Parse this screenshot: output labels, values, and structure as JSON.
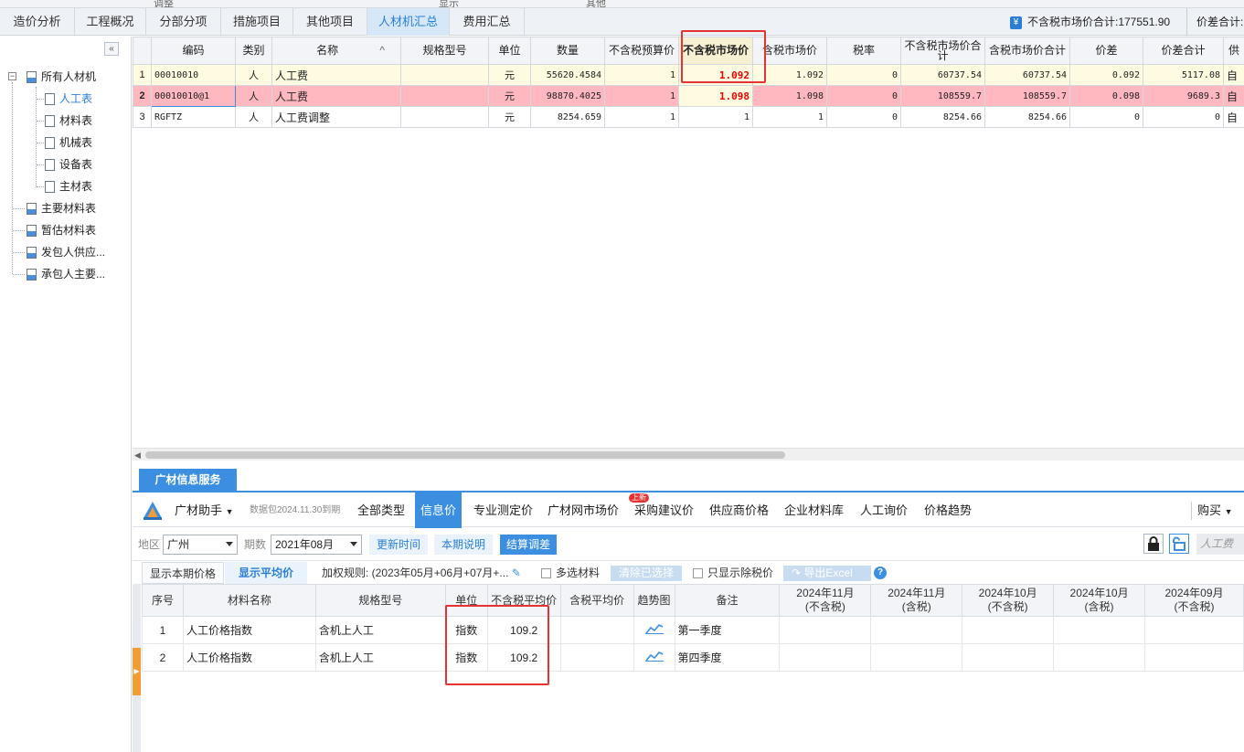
{
  "top_strip": [
    "调整",
    "显示",
    "其他"
  ],
  "tabs": [
    {
      "label": "造价分析",
      "active": false
    },
    {
      "label": "工程概况",
      "active": false
    },
    {
      "label": "分部分项",
      "active": false
    },
    {
      "label": "措施项目",
      "active": false
    },
    {
      "label": "其他项目",
      "active": false
    },
    {
      "label": "人材机汇总",
      "active": true
    },
    {
      "label": "费用汇总",
      "active": false
    }
  ],
  "totals": {
    "market_total": "不含税市场价合计:177551.90",
    "diff_total": "价差合计:"
  },
  "tree": {
    "collapse": "«",
    "root": "所有人材机",
    "children": [
      "人工表",
      "材料表",
      "机械表",
      "设备表",
      "主材表"
    ],
    "others": [
      "主要材料表",
      "暂估材料表",
      "发包人供应...",
      "承包人主要..."
    ]
  },
  "grid": {
    "headers": [
      "编码",
      "类别",
      "名称",
      "规格型号",
      "单位",
      "数量",
      "不含税预算价",
      "不含税市场价",
      "含税市场价",
      "税率",
      "不含税市场价合计",
      "含税市场价合计",
      "价差",
      "价差合计",
      "供"
    ],
    "sort_arrow": "^",
    "rows": [
      {
        "idx": "1",
        "code": "00010010",
        "type": "人",
        "name": "人工费",
        "spec": "",
        "unit": "元",
        "qty": "55620.4584",
        "budget": "1",
        "market": "1.092",
        "market_tax": "1.092",
        "rate": "0",
        "market_total": "60737.54",
        "market_tax_total": "60737.54",
        "diff": "0.092",
        "diff_total": "5117.08",
        "supply": "自"
      },
      {
        "idx": "2",
        "code": "00010010@1",
        "type": "人",
        "name": "人工费",
        "spec": "",
        "unit": "元",
        "qty": "98870.4025",
        "budget": "1",
        "market": "1.098",
        "market_tax": "1.098",
        "rate": "0",
        "market_total": "108559.7",
        "market_tax_total": "108559.7",
        "diff": "0.098",
        "diff_total": "9689.3",
        "supply": "自"
      },
      {
        "idx": "3",
        "code": "RGFTZ",
        "type": "人",
        "name": "人工费调整",
        "spec": "",
        "unit": "元",
        "qty": "8254.659",
        "budget": "1",
        "market": "1",
        "market_tax": "1",
        "rate": "0",
        "market_total": "8254.66",
        "market_tax_total": "8254.66",
        "diff": "0",
        "diff_total": "0",
        "supply": "自"
      }
    ]
  },
  "panel": {
    "tab": "广材信息服务",
    "assistant": "广材助手",
    "package": "数据包2024.11.30到期",
    "nav": [
      "全部类型",
      "信息价",
      "专业测定价",
      "广材网市场价",
      "采购建议价",
      "供应商价格",
      "企业材料库",
      "人工询价",
      "价格趋势"
    ],
    "new_badge": "上新",
    "buy": "购买",
    "region_label": "地区",
    "region": "广州",
    "period_label": "期数",
    "period": "2021年08月",
    "btn_update": "更新时间",
    "btn_note": "本期说明",
    "btn_settle": "结算调差",
    "search_placeholder": "人工费",
    "opt_current": "显示本期价格",
    "opt_avg": "显示平均价",
    "rule": "加权规则: (2023年05月+06月+07月+...",
    "multi": "多选材料",
    "clear": "清除已选择",
    "only_tax": "只显示除税价",
    "export": "导出Excel",
    "help": "?",
    "headers": [
      "序号",
      "材料名称",
      "规格型号",
      "单位",
      "不含税平均价",
      "含税平均价",
      "趋势图",
      "备注",
      "2024年11月\n(不含税)",
      "2024年11月\n(含税)",
      "2024年10月\n(不含税)",
      "2024年10月\n(含税)",
      "2024年09月\n(不含税)"
    ],
    "rows": [
      {
        "idx": "1",
        "name": "人工价格指数",
        "spec": "含机上人工",
        "unit": "指数",
        "avg": "109.2",
        "avg_tax": "",
        "note": "第一季度"
      },
      {
        "idx": "2",
        "name": "人工价格指数",
        "spec": "含机上人工",
        "unit": "指数",
        "avg": "109.2",
        "avg_tax": "",
        "note": "第四季度"
      }
    ]
  },
  "colors": {
    "accent": "#3c8fe0",
    "highlight_red": "#e53333",
    "row_pink": "#ffb8c0",
    "row_yellow": "#fffbe0"
  }
}
